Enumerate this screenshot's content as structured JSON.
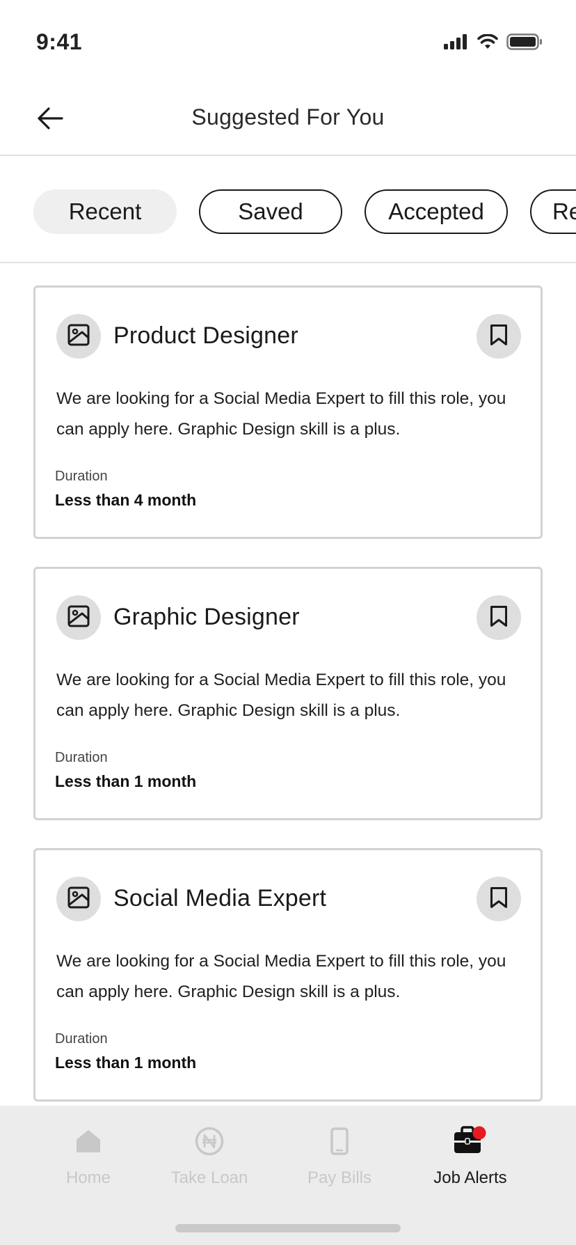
{
  "status_bar": {
    "time": "9:41",
    "icons": [
      "signal-icon",
      "wifi-icon",
      "battery-icon"
    ]
  },
  "header": {
    "title": "Suggested For You",
    "back_icon": "arrow-left-icon"
  },
  "tabs": [
    {
      "label": "Recent",
      "active": true
    },
    {
      "label": "Saved",
      "active": false
    },
    {
      "label": "Accepted",
      "active": false
    },
    {
      "label": "Re",
      "active": false
    }
  ],
  "jobs": [
    {
      "title": "Product Designer",
      "description": "We are looking for a Social Media Expert to fill this role, you can apply here. Graphic Design skill is a plus.",
      "duration_label": "Duration",
      "duration_value": "Less than 4 month",
      "icon": "image-icon",
      "bookmark_icon": "bookmark-icon"
    },
    {
      "title": "Graphic Designer",
      "description": "We are looking for a Social Media Expert to fill this role, you can apply here. Graphic Design skill is a plus.",
      "duration_label": "Duration",
      "duration_value": "Less than 1 month",
      "icon": "image-icon",
      "bookmark_icon": "bookmark-icon"
    },
    {
      "title": "Social Media Expert",
      "description": "We are looking for a Social Media Expert to fill this role, you can apply here. Graphic Design skill is a plus.",
      "duration_label": "Duration",
      "duration_value": "Less than 1 month",
      "icon": "image-icon",
      "bookmark_icon": "bookmark-icon"
    }
  ],
  "bottom_nav": [
    {
      "label": "Home",
      "icon": "home-icon",
      "active": false
    },
    {
      "label": "Take Loan",
      "icon": "naira-icon",
      "active": false
    },
    {
      "label": "Pay Bills",
      "icon": "phone-icon",
      "active": false
    },
    {
      "label": "Job Alerts",
      "icon": "briefcase-icon",
      "active": true,
      "badge": true
    }
  ],
  "colors": {
    "accent_badge": "#e8191f",
    "inactive_nav": "#c8c8c8",
    "chip_bg": "#efefef",
    "icon_circle": "#dedede"
  }
}
